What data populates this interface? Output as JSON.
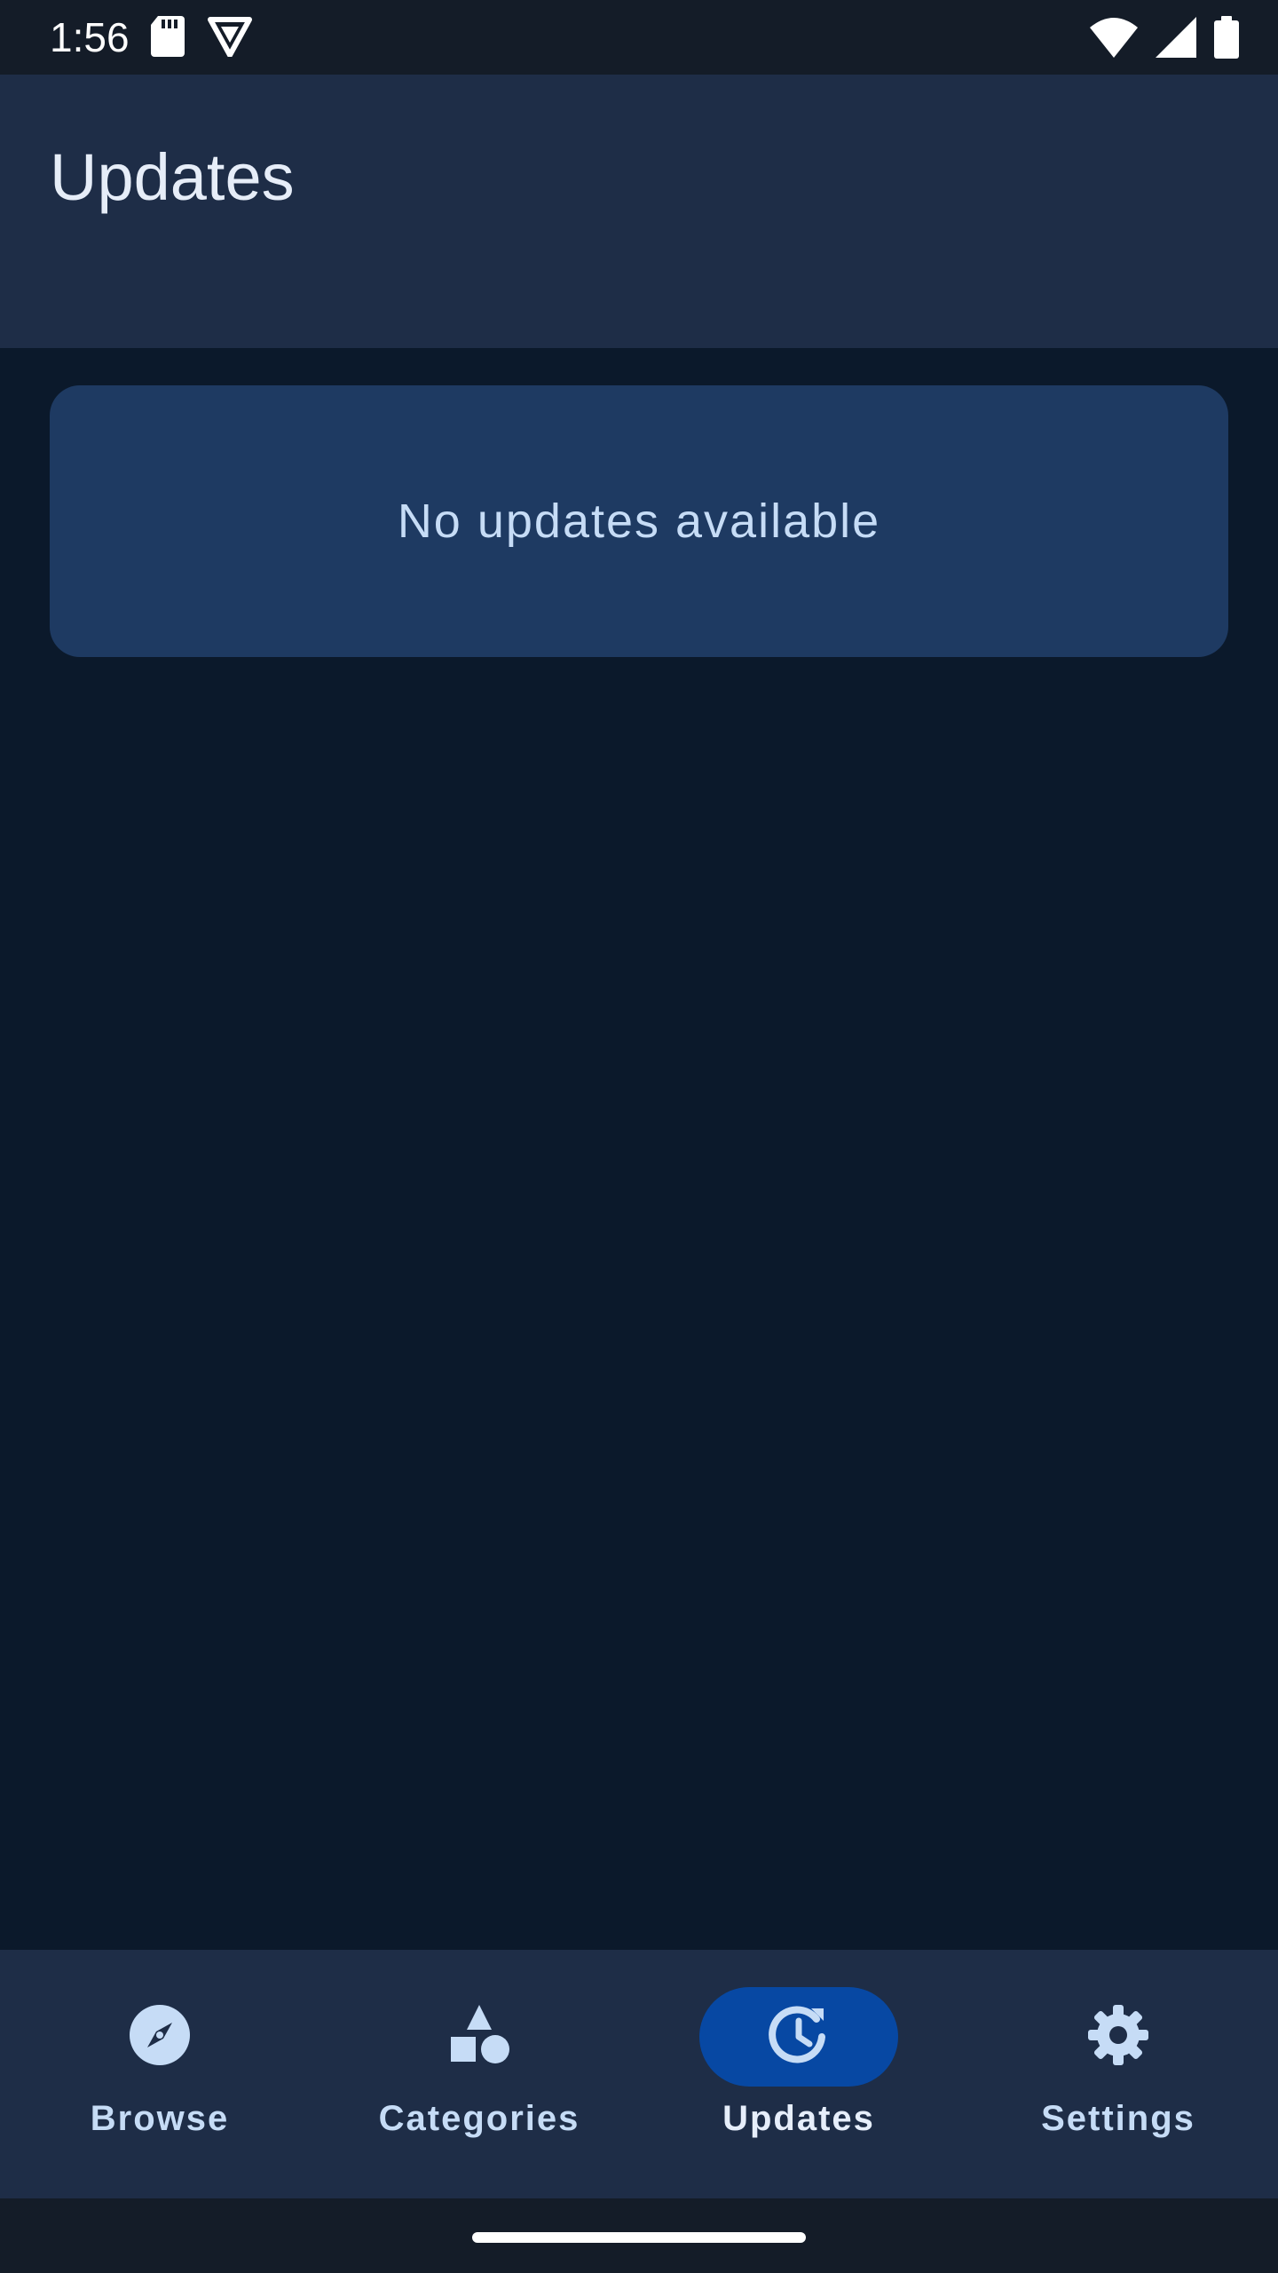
{
  "status_bar": {
    "time": "1:56",
    "left_icons": [
      "sd-card-icon",
      "shield-icon"
    ],
    "right_icons": [
      "wifi-icon",
      "cellular-signal-icon",
      "battery-icon"
    ]
  },
  "app_bar": {
    "title": "Updates"
  },
  "content": {
    "empty_message": "No updates available"
  },
  "bottom_nav": {
    "items": [
      {
        "label": "Browse",
        "icon": "compass-icon",
        "active": false
      },
      {
        "label": "Categories",
        "icon": "shapes-icon",
        "active": false
      },
      {
        "label": "Updates",
        "icon": "update-clock-icon",
        "active": true
      },
      {
        "label": "Settings",
        "icon": "gear-icon",
        "active": false
      }
    ]
  },
  "colors": {
    "background": "#0b192b",
    "surface": "#1e2d47",
    "card": "#1e3a62",
    "accent": "#0748a3",
    "on_surface": "#c6dcf6"
  }
}
